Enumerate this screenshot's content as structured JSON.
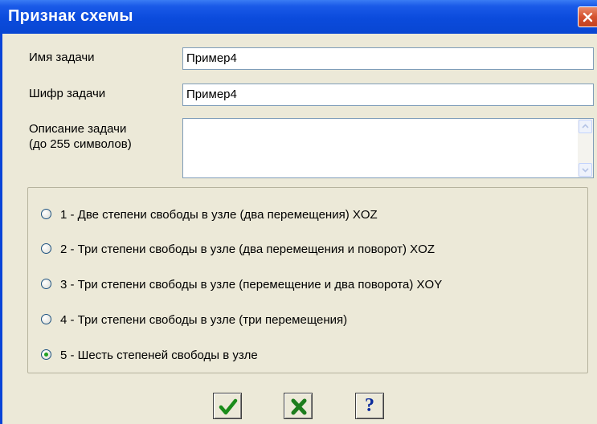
{
  "window": {
    "title": "Признак схемы"
  },
  "form": {
    "name_label": "Имя задачи",
    "name_value": "Пример4",
    "code_label": "Шифр задачи",
    "code_value": "Пример4",
    "desc_label_line1": "Описание задачи",
    "desc_label_line2": "(до 255 символов)",
    "desc_value": ""
  },
  "scheme_options": [
    {
      "label": "1 - Две степени свободы в узле (два перемещения) XOZ",
      "checked": false
    },
    {
      "label": "2 - Три степени свободы в узле (два перемещения и поворот) XOZ",
      "checked": false
    },
    {
      "label": "3 - Три степени свободы в узле (перемещение и два поворота) XOY",
      "checked": false
    },
    {
      "label": "4 - Три степени свободы в узле (три перемещения)",
      "checked": false
    },
    {
      "label": "5 - Шесть степеней свободы в узле",
      "checked": true
    }
  ],
  "buttons": {
    "ok_icon": "check-icon",
    "cancel_icon": "x-icon",
    "help_label": "?"
  },
  "colors": {
    "titlebar": "#0b4bdc",
    "dialog_bg": "#ece9d8",
    "ok_green": "#1a8c1a",
    "cancel_green": "#1d7d1d",
    "help_blue": "#0a2a9c"
  }
}
